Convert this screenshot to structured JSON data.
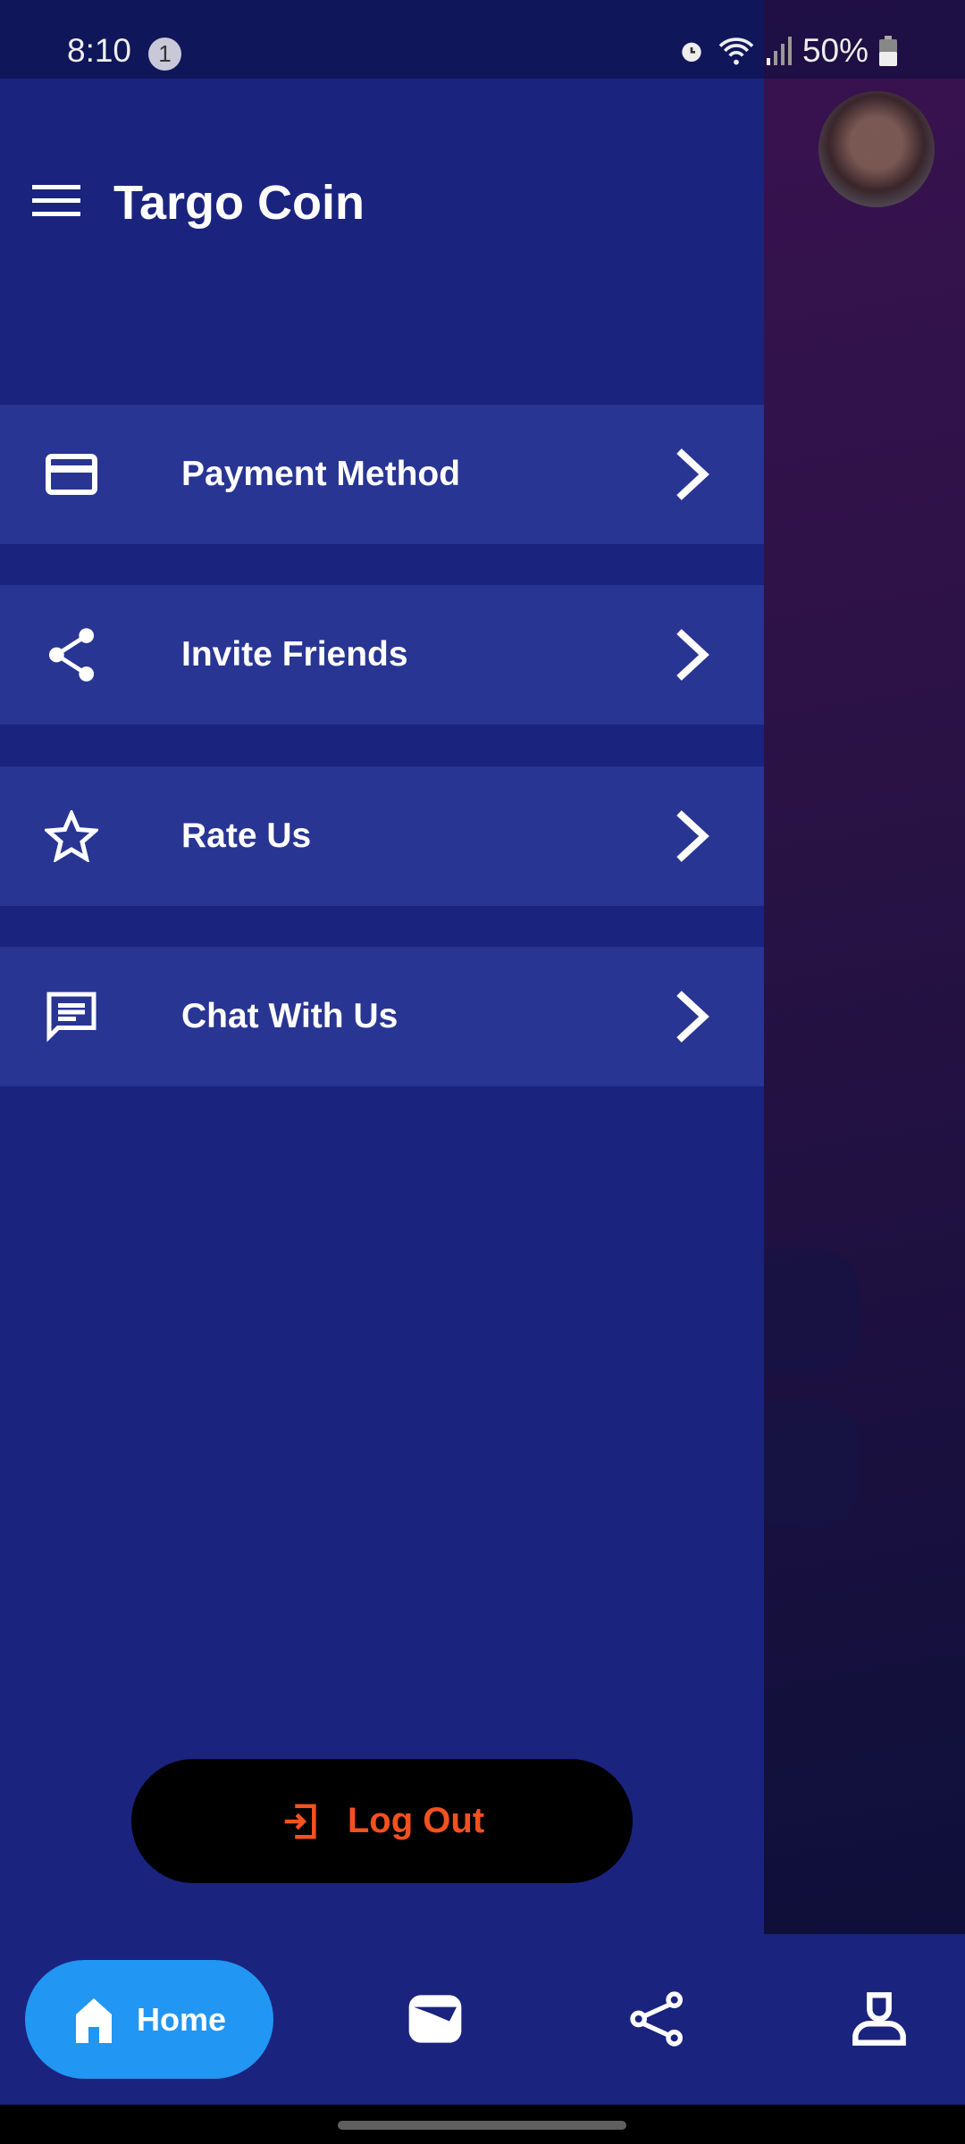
{
  "status_bar": {
    "time": "8:10",
    "notification_count": "1",
    "battery": "50%"
  },
  "drawer": {
    "title": "Targo Coin",
    "items": [
      {
        "label": "Payment Method",
        "icon": "credit-card-icon"
      },
      {
        "label": "Invite Friends",
        "icon": "share-icon"
      },
      {
        "label": "Rate Us",
        "icon": "star-icon"
      },
      {
        "label": "Chat With Us",
        "icon": "chat-icon"
      }
    ],
    "logout_label": "Log Out"
  },
  "bottom_nav": {
    "items": [
      {
        "label": "Home",
        "icon": "home-icon",
        "active": true
      },
      {
        "icon": "wallet-icon"
      },
      {
        "icon": "share-icon"
      },
      {
        "icon": "profile-icon"
      }
    ]
  },
  "colors": {
    "drawer": "#1a237e",
    "item": "#283593",
    "accent": "#2196f3",
    "logout": "#f4511e"
  }
}
